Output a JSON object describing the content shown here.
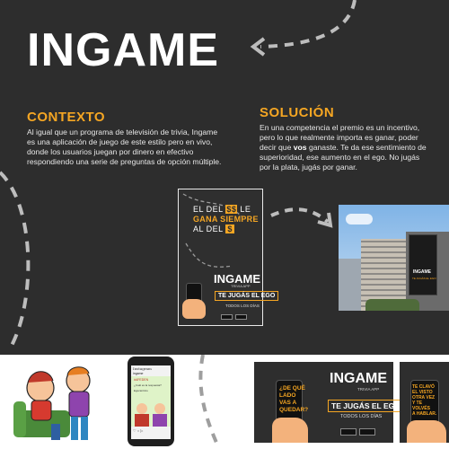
{
  "title": "INGAME",
  "contexto": {
    "heading": "CONTEXTO",
    "text": "Al igual que un programa de televisión de trivia, Ingame es una aplicación de juego de este estilo pero en vivo, donde los usuarios juegan por dinero en efectivo respondiendo una serie de preguntas de opción múltiple."
  },
  "solucion": {
    "heading": "SOLUCIÓN",
    "line1": "En una competencia el premio es un incentivo,",
    "line2": "pero lo que realmente importa es ganar, poder",
    "line3_pre": "decir que ",
    "line3_bold": "vos",
    "line3_post": " ganaste. Te da ese sentimiento de",
    "line4": "superioridad, ese aumento en el ego. No jugás",
    "line5": "por la plata, jugás por ganar."
  },
  "poster": {
    "headline_1": "EL DEL",
    "headline_money1": "$$",
    "headline_le": "LE",
    "headline_2": "GANA SIEMPRE",
    "headline_3": "AL DEL",
    "headline_money2": "$",
    "logo": "INGAME",
    "logo_sub": "TRIVIA APP",
    "tagline": "TE JUGÁS EL EGO",
    "subtag": "TODOS LOS DÍAS"
  },
  "billboard": {
    "logo": "INGAME",
    "tagline": "TE JUGÁS EL EGO"
  },
  "print_ad": {
    "question": "¿DE QUÉ LADO VAS A QUEDAR?",
    "q1": "¿DE QUÉ",
    "q2": "LADO",
    "q3": "VAS A",
    "q4": "QUEDAR?",
    "logo": "INGAME",
    "logo_sub": "TRIVIA APP",
    "tagline": "TE JUGÁS EL EGO",
    "subtag": "TODOS LOS DÍAS"
  },
  "print_ad_2": {
    "l1": "TE CLAVÓ",
    "l2": "EL VISTO",
    "l3": "OTRA VEZ",
    "l4": "Y TE",
    "l5": "VOLVÉS",
    "l6": "A HABLAR."
  },
  "phone_post": {
    "app": "Instagram",
    "user": "ingame",
    "hashtag": "#AFEDEN",
    "question": "¿Cuál es la respuesta?",
    "answer": "Egocéntrico"
  },
  "colors": {
    "accent": "#f5a623",
    "background": "#2d2d2d",
    "text": "#e6e6e6"
  }
}
